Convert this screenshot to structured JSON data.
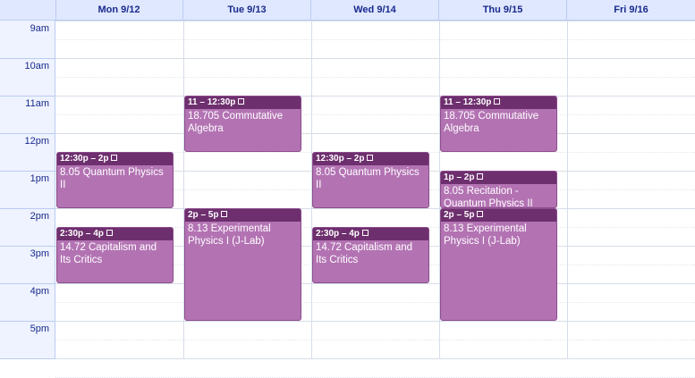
{
  "days": [
    "Mon 9/12",
    "Tue 9/13",
    "Wed 9/14",
    "Thu 9/15",
    "Fri 9/16"
  ],
  "hours": [
    "9am",
    "10am",
    "11am",
    "12pm",
    "1pm",
    "2pm",
    "3pm",
    "4pm",
    "5pm"
  ],
  "events": [
    {
      "day": 0,
      "start": 12.5,
      "end": 14.0,
      "time": "12:30p – 2p",
      "title": "8.05 Quantum Physics II"
    },
    {
      "day": 0,
      "start": 14.5,
      "end": 16.0,
      "time": "2:30p – 4p",
      "title": "14.72 Capitalism and Its Critics"
    },
    {
      "day": 1,
      "start": 11.0,
      "end": 12.5,
      "time": "11 – 12:30p",
      "title": "18.705 Commutative Algebra"
    },
    {
      "day": 1,
      "start": 14.0,
      "end": 17.0,
      "time": "2p – 5p",
      "title": "8.13 Experimental Physics I (J-Lab)"
    },
    {
      "day": 2,
      "start": 12.5,
      "end": 14.0,
      "time": "12:30p – 2p",
      "title": "8.05 Quantum Physics II"
    },
    {
      "day": 2,
      "start": 14.5,
      "end": 16.0,
      "time": "2:30p – 4p",
      "title": "14.72 Capitalism and Its Critics"
    },
    {
      "day": 3,
      "start": 11.0,
      "end": 12.5,
      "time": "11 – 12:30p",
      "title": "18.705 Commutative Algebra"
    },
    {
      "day": 3,
      "start": 13.0,
      "end": 14.0,
      "time": "1p – 2p",
      "title": "8.05 Recitation - Quantum Physics II"
    },
    {
      "day": 3,
      "start": 14.0,
      "end": 17.0,
      "time": "2p – 5p",
      "title": "8.13 Experimental Physics I (J-Lab)"
    }
  ],
  "colors": {
    "event_fill": "#b373b3",
    "event_header": "#6e2f6e",
    "header_bg": "#dfe8ff",
    "header_text": "#1a2a8c"
  },
  "icons": {
    "event_expand": "expand-icon"
  }
}
